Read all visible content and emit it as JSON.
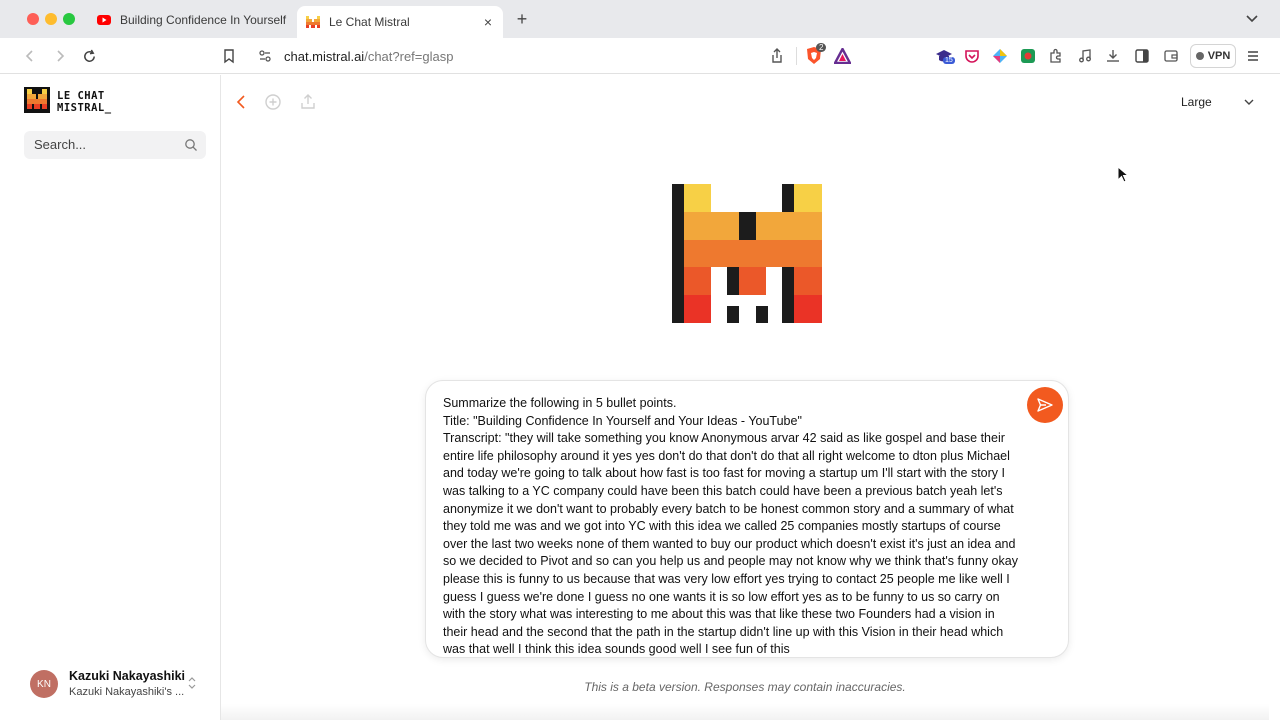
{
  "browser": {
    "tabs": [
      {
        "title": "Building Confidence In Yourself and Your Ideas - YouTube",
        "favicon": "youtube-icon",
        "active": false
      },
      {
        "title": "Le Chat Mistral",
        "favicon": "mistral-icon",
        "active": true
      }
    ],
    "tab_close_glyph": "×",
    "new_tab_glyph": "+",
    "url": {
      "host": "chat.mistral.ai",
      "path": "/chat?ref=glasp"
    },
    "extension_badge": "15",
    "brave_badge": "2",
    "vpn_label": "VPN"
  },
  "sidebar": {
    "logo_line1": "LE CHAT",
    "logo_line2": "MISTRAL_",
    "search_placeholder": "Search...",
    "user": {
      "initials": "KN",
      "name": "Kazuki Nakayashiki",
      "workspace": "Kazuki Nakayashiki's ..."
    }
  },
  "main": {
    "model": "Large",
    "prompt": "Summarize the following in 5 bullet points.\nTitle: \"Building Confidence In Yourself and Your Ideas - YouTube\"\nTranscript: \"they will take something you know Anonymous arvar 42 said as like gospel and base their entire life philosophy around it yes yes don't do that don't do that all right welcome to dton plus Michael and today we're going to talk about how fast is too fast for moving a startup um I'll start with the story I was talking to a YC company could have been this batch could have been a previous batch yeah let's anonymize it we don't want to probably every batch to be honest common story and a summary of what they told me was and we got into YC with this idea we called 25 companies mostly startups of course over the last two weeks none of them wanted to buy our product which doesn't exist it's just an idea and so we decided to Pivot and so can you help us and people may not know why we think that's funny okay please this is funny to us because that was very low effort yes trying to contact 25 people me like well I guess I guess we're done I guess no one wants it is so low effort yes as to be funny to us so carry on with the story what was interesting to me about this was that like these two Founders had a vision in their head and the second that the path in the startup didn't line up with this Vision in their head which was that well I think this idea sounds good well I see fun of this",
    "disclaimer": "This is a beta version. Responses may contain inaccuracies."
  },
  "colors": {
    "accent": "#f25a1f",
    "avatar": "#c06f63"
  }
}
